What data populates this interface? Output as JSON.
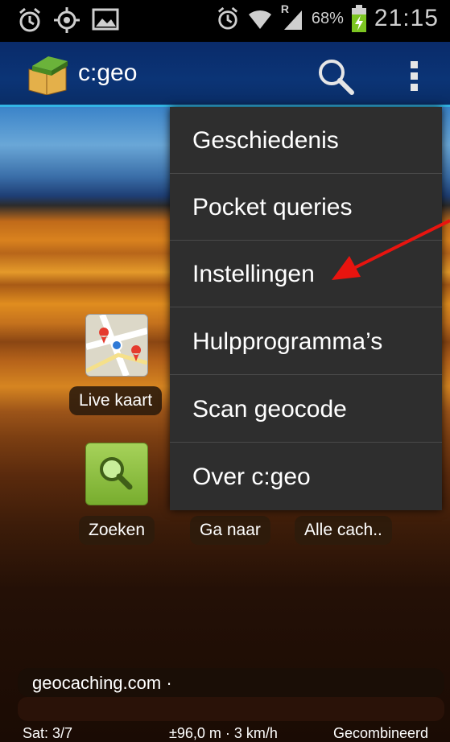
{
  "status_bar": {
    "battery_pct": "68%",
    "time": "21:15",
    "network_badge": "R",
    "icons": [
      "alarm-icon",
      "gps-icon",
      "image-icon",
      "alarm-icon",
      "wifi-icon",
      "signal-icon",
      "battery-charging-icon"
    ]
  },
  "action_bar": {
    "title": "c:geo",
    "icons": [
      "cgeo-app-icon",
      "search-icon",
      "overflow-menu-icon"
    ]
  },
  "home": {
    "live_map_label": "Live kaart",
    "search_label": "Zoeken",
    "goto_label": "Ga naar",
    "all_caches_label": "Alle cach.."
  },
  "menu": {
    "items": [
      {
        "label": "Geschiedenis"
      },
      {
        "label": "Pocket queries"
      },
      {
        "label": "Instellingen"
      },
      {
        "label": "Hulpprogramma’s"
      },
      {
        "label": "Scan geocode"
      },
      {
        "label": "Over c:geo"
      }
    ]
  },
  "footer": {
    "connection": "geocaching.com ·",
    "satellites": "Sat: 3/7",
    "accuracy": "±96,0 m · 3 km/h",
    "mode": "Gecombineerd"
  },
  "colors": {
    "accent": "#33b5e5",
    "menu_bg": "#2e2e2e",
    "annotation_arrow": "#e8140f"
  }
}
